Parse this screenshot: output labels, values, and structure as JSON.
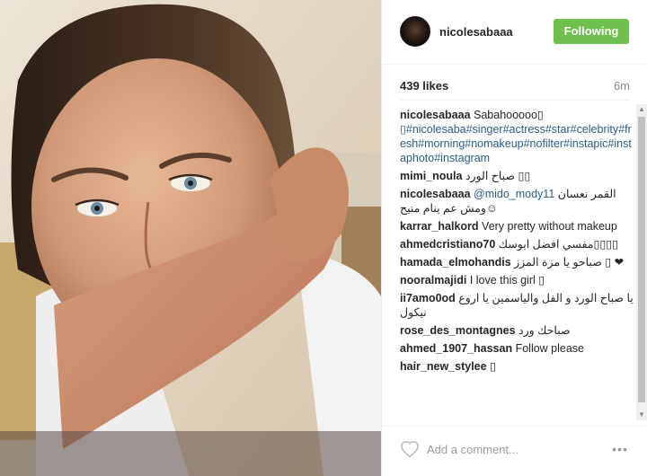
{
  "header": {
    "username": "nicolesabaaa",
    "follow_label": "Following"
  },
  "stats": {
    "likes": "439 likes",
    "time": "6m"
  },
  "caption": {
    "user": "nicolesabaaa",
    "text": "Sabahooooo▯ ",
    "hashtags": "▯#nicolesaba#singer#actress#star#celebrity#fresh#morning#nomakeup#nofilter#instapic#instaphoto#instagram"
  },
  "comments": [
    {
      "user": "mimi_noula",
      "text": "صباح الورد ▯▯"
    },
    {
      "user": "nicolesabaaa",
      "mention": "@mido_mody11",
      "text": " القمر نعسان ومش عم ينام منيح☺"
    },
    {
      "user": "karrar_halkord",
      "text": "Very pretty without makeup"
    },
    {
      "user": "ahmedcristiano70",
      "text": "مفسي افضل ابوسك▯▯▯▯"
    },
    {
      "user": "hamada_elmohandis",
      "text": "صباحو يا مزة المزز ▯ ❤"
    },
    {
      "user": "nooralmajidi",
      "text": "I love this girl ▯"
    },
    {
      "user": "ii7amo0od",
      "text": "يا صباح الورد و الفل والياسمين يا اروع نيكول"
    },
    {
      "user": "rose_des_montagnes",
      "text": "صباحك ورد"
    },
    {
      "user": "ahmed_1907_hassan",
      "text": "Follow please"
    },
    {
      "user": "hair_new_stylee",
      "text": "▯"
    }
  ],
  "footer": {
    "placeholder": "Add a comment...",
    "more_label": "•••"
  },
  "icons": {
    "avatar": "avatar",
    "heart": "heart-icon",
    "more": "more-options-icon"
  },
  "colors": {
    "follow_button": "#70c050",
    "hashtag": "#2a5c8a",
    "muted": "#8a8a8a"
  }
}
